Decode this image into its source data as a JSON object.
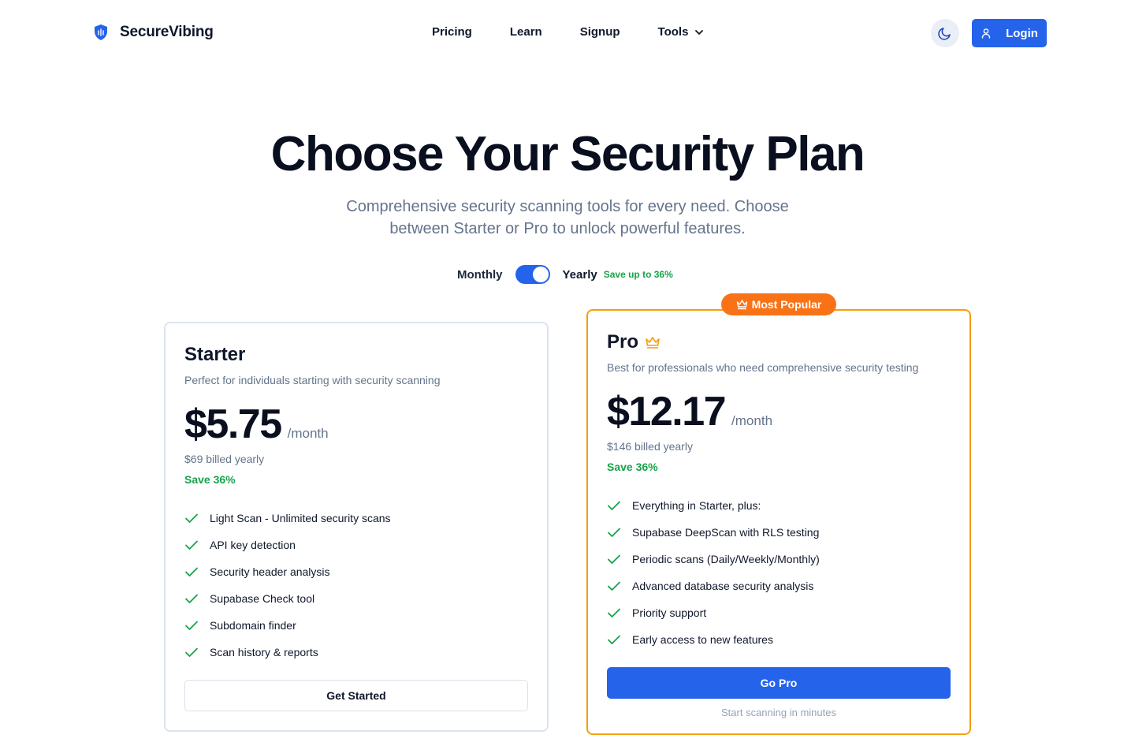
{
  "nav": {
    "brand": "SecureVibing",
    "links": [
      "Pricing",
      "Learn",
      "Signup",
      "Tools"
    ],
    "login_label": "Login"
  },
  "hero": {
    "title": "Choose Your Security Plan",
    "subtitle": "Comprehensive security scanning tools for every need. Choose between Starter or Pro to unlock powerful features."
  },
  "billing": {
    "monthly_label": "Monthly",
    "yearly_label": "Yearly",
    "save_hint": "Save up to 36%",
    "selected": "Yearly"
  },
  "plans": {
    "starter": {
      "name": "Starter",
      "description": "Perfect for individuals starting with security scanning",
      "price": "$5.75",
      "period": "/month",
      "billed": "$69 billed yearly",
      "save": "Save 36%",
      "features": [
        "Light Scan - Unlimited security scans",
        "API key detection",
        "Security header analysis",
        "Supabase Check tool",
        "Subdomain finder",
        "Scan history & reports"
      ],
      "cta": "Get Started"
    },
    "pro": {
      "badge": "Most Popular",
      "name": "Pro",
      "description": "Best for professionals who need comprehensive security testing",
      "price": "$12.17",
      "period": "/month",
      "billed": "$146 billed yearly",
      "save": "Save 36%",
      "features": [
        "Everything in Starter, plus:",
        "Supabase DeepScan with RLS testing",
        "Periodic scans (Daily/Weekly/Monthly)",
        "Advanced database security analysis",
        "Priority support",
        "Early access to new features"
      ],
      "cta": "Go Pro",
      "footnote": "Start scanning in minutes"
    }
  },
  "colors": {
    "accent": "#2563eb",
    "pro_border": "#f59e0b",
    "badge": "#f97316",
    "success": "#16a34a"
  },
  "icons": {
    "brand": "shield-icon",
    "theme": "moon-icon",
    "login": "user-icon",
    "crown": "crown-icon",
    "check": "check-icon"
  }
}
